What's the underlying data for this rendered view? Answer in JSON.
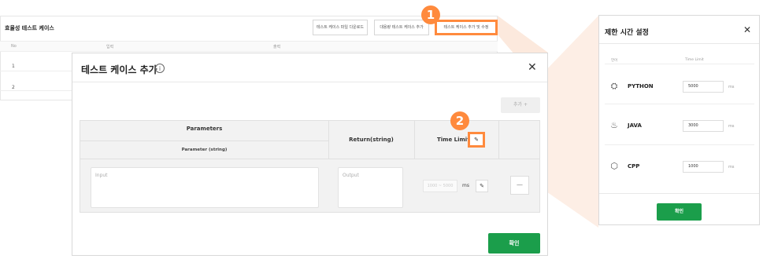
{
  "background_page": {
    "title": "효율성 테스트 케이스",
    "buttons": {
      "download": "테스트 케이스 파일 다운로드",
      "bulk_add": "대용량 테스트 케이스 추가",
      "add_edit": "테스트 케이스 추가 및 수정"
    },
    "columns": [
      "No",
      "입력",
      "출력"
    ],
    "rows": [
      "1",
      "2"
    ]
  },
  "badges": {
    "step1": "1",
    "step2": "2"
  },
  "modal": {
    "title": "테스트 케이스 추가",
    "info_icon": "info-icon",
    "close": "✕",
    "add_button": "추가 +",
    "table": {
      "parameters_header": "Parameters",
      "parameter_type": "Parameter (string)",
      "return_header": "Return(string)",
      "time_limit_header": "Time Limit"
    },
    "row": {
      "input_placeholder": "Input",
      "output_placeholder": "Output",
      "time_placeholder": "1000 ~ 5000",
      "time_unit": "ms",
      "remove": "—"
    },
    "confirm": "확인"
  },
  "time_panel": {
    "title": "제한 시간 설정",
    "close": "✕",
    "columns": {
      "language": "언어",
      "time_limit": "Time Limit"
    },
    "languages": [
      {
        "name": "PYTHON",
        "value": "5000",
        "unit": "ms",
        "icon": "python-icon"
      },
      {
        "name": "JAVA",
        "value": "3000",
        "unit": "ms",
        "icon": "java-icon"
      },
      {
        "name": "CPP",
        "value": "1000",
        "unit": "ms",
        "icon": "cpp-icon"
      }
    ],
    "confirm": "확인"
  },
  "colors": {
    "accent": "#ff8a3d",
    "confirm": "#1b9e4b"
  }
}
